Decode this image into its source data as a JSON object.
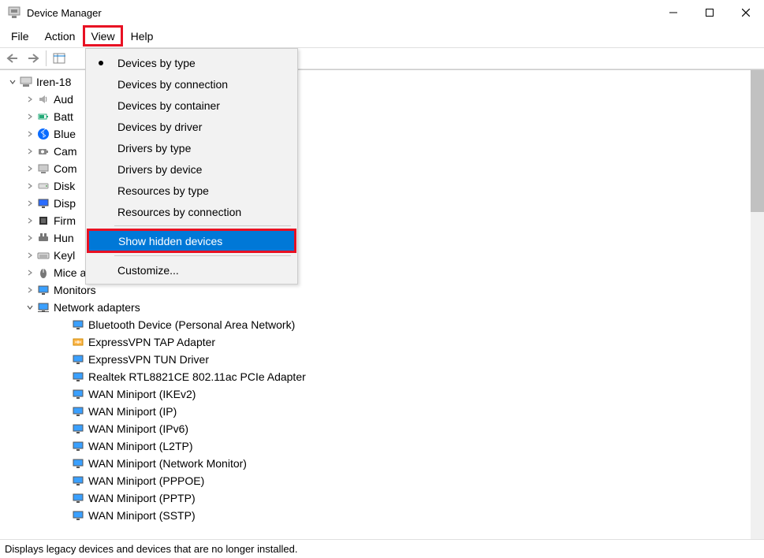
{
  "window": {
    "title": "Device Manager"
  },
  "menubar": [
    "File",
    "Action",
    "View",
    "Help"
  ],
  "menubar_highlighted": 2,
  "viewmenu": {
    "items": [
      {
        "label": "Devices by type",
        "checked": true
      },
      {
        "label": "Devices by connection",
        "checked": false
      },
      {
        "label": "Devices by container",
        "checked": false
      },
      {
        "label": "Devices by driver",
        "checked": false
      },
      {
        "label": "Drivers by type",
        "checked": false
      },
      {
        "label": "Drivers by device",
        "checked": false
      },
      {
        "label": "Resources by type",
        "checked": false
      },
      {
        "label": "Resources by connection",
        "checked": false
      }
    ],
    "show_hidden": "Show hidden devices",
    "customize": "Customize..."
  },
  "tree": {
    "root": "Iren-18",
    "categories": [
      {
        "label": "Aud",
        "icon": "audio"
      },
      {
        "label": "Batt",
        "icon": "battery"
      },
      {
        "label": "Blue",
        "icon": "bluetooth"
      },
      {
        "label": "Cam",
        "icon": "camera"
      },
      {
        "label": "Com",
        "icon": "computer"
      },
      {
        "label": "Disk",
        "icon": "disk"
      },
      {
        "label": "Disp",
        "icon": "display"
      },
      {
        "label": "Firm",
        "icon": "firmware"
      },
      {
        "label": "Hun",
        "icon": "hid"
      },
      {
        "label": "Keyl",
        "icon": "keyboard"
      },
      {
        "label": "Mice and other pointing devices",
        "icon": "mouse"
      },
      {
        "label": "Monitors",
        "icon": "monitor"
      },
      {
        "label": "Network adapters",
        "icon": "network",
        "expanded": true
      }
    ],
    "network_children": [
      "Bluetooth Device (Personal Area Network)",
      "ExpressVPN TAP Adapter",
      "ExpressVPN TUN Driver",
      "Realtek RTL8821CE 802.11ac PCIe Adapter",
      "WAN Miniport (IKEv2)",
      "WAN Miniport (IP)",
      "WAN Miniport (IPv6)",
      "WAN Miniport (L2TP)",
      "WAN Miniport (Network Monitor)",
      "WAN Miniport (PPPOE)",
      "WAN Miniport (PPTP)",
      "WAN Miniport (SSTP)"
    ]
  },
  "statusbar": "Displays legacy devices and devices that are no longer installed."
}
